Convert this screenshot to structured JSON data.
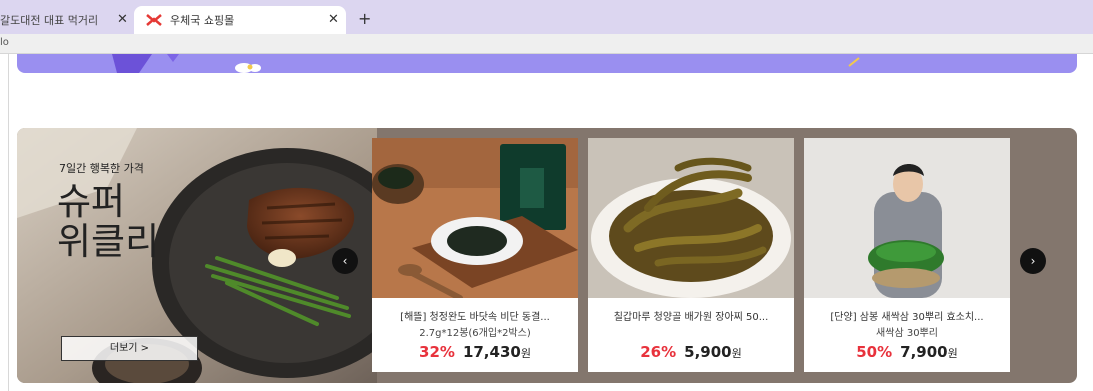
{
  "browser": {
    "tabs": [
      {
        "label": "갈도대전 대표 먹거리",
        "close": "✕"
      },
      {
        "label": "우체국 쇼핑몰",
        "close": "✕"
      }
    ],
    "new_tab": "+",
    "address_text": "lo"
  },
  "weekly": {
    "subtitle": "7일간 행복한 가격",
    "title_line1": "슈퍼",
    "title_line2": "위클리",
    "more_label": "더보기 >",
    "prev_arrow": "‹",
    "next_arrow": "›"
  },
  "products": [
    {
      "name": "[해뜰] 청정완도 바닷속 비단 동결...",
      "option": "2.7g*12봉(6개입*2박스)",
      "discount": "32%",
      "price": "17,430",
      "unit": "원"
    },
    {
      "name": "칠갑마루 청양골 배가원 장아찌 50...",
      "option": "",
      "discount": "26%",
      "price": "5,900",
      "unit": "원"
    },
    {
      "name": "[단양] 삼봉 새싹삼 30뿌리 효소치...",
      "option": "새싹삼 30뿌리",
      "discount": "50%",
      "price": "7,900",
      "unit": "원"
    }
  ],
  "colors": {
    "accent_discount": "#e8323c",
    "tab_bar": "#dcd6f0",
    "weekly_bg": "#83766d",
    "banner": "#9a8ff0"
  },
  "icons": [
    "post-office-favicon-icon",
    "close-icon",
    "plus-icon",
    "chevron-left-icon",
    "chevron-right-icon"
  ]
}
